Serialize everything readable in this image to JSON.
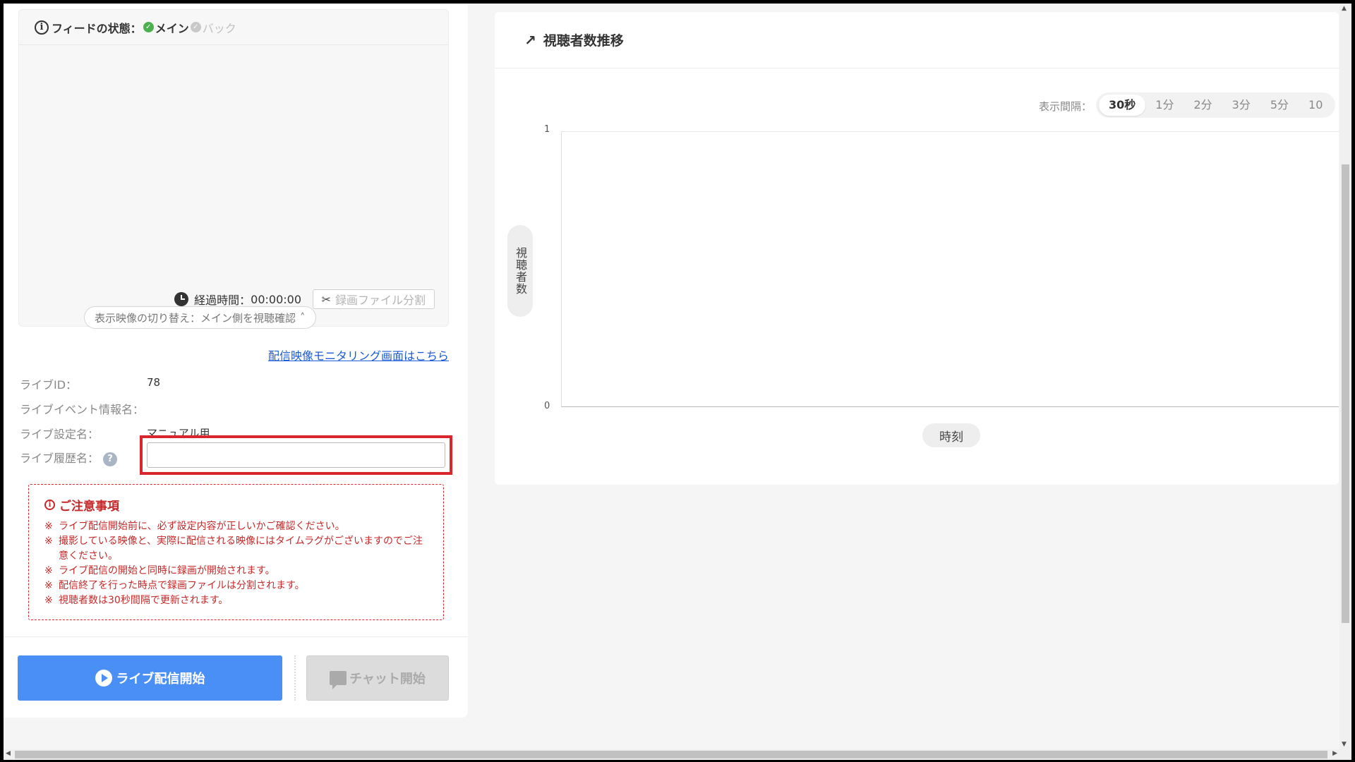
{
  "feed": {
    "label": "フィードの状態：",
    "main": "メイン",
    "back": "バック"
  },
  "video": {
    "elapsed_label": "経過時間：",
    "elapsed_value": "00:00:00",
    "split_button": "録画ファイル分割",
    "switch_button": "表示映像の切り替え：メイン側を視聴確認"
  },
  "monitor_link": "配信映像モニタリング画面はこちら",
  "info": {
    "live_id_label": "ライブID：",
    "live_id_value": "78",
    "event_name_label": "ライブイベント情報名：",
    "event_name_value": "",
    "setting_name_label": "ライブ設定名：",
    "setting_name_value": "マニュアル用",
    "history_name_label": "ライブ履歴名：",
    "history_name_value": ""
  },
  "notice": {
    "title": "ご注意事項",
    "items": [
      "ライブ配信開始前に、必ず設定内容が正しいかご確認ください。",
      "撮影している映像と、実際に配信される映像にはタイムラグがございますのでご注意ください。",
      "ライブ配信の開始と同時に録画が開始されます。",
      "配信終了を行った時点で録画ファイルは分割されます。",
      "視聴者数は30秒間隔で更新されます。"
    ]
  },
  "buttons": {
    "live_start": "ライブ配信開始",
    "chat_start": "チャット開始"
  },
  "chart_panel": {
    "title": "視聴者数推移",
    "interval_label": "表示間隔：",
    "intervals": [
      "30秒",
      "1分",
      "2分",
      "3分",
      "5分",
      "10"
    ],
    "active_interval": "30秒"
  },
  "chart_data": {
    "type": "line",
    "title": "視聴者数推移",
    "xlabel": "時刻",
    "ylabel": "視聴者数",
    "ylim": [
      0,
      1
    ],
    "y_ticks": [
      "1",
      "0"
    ],
    "x": [],
    "series": []
  },
  "colors": {
    "primary": "#4a8ff5",
    "danger": "#d9262c",
    "success": "#4caf50",
    "link": "#1a5bd6"
  }
}
